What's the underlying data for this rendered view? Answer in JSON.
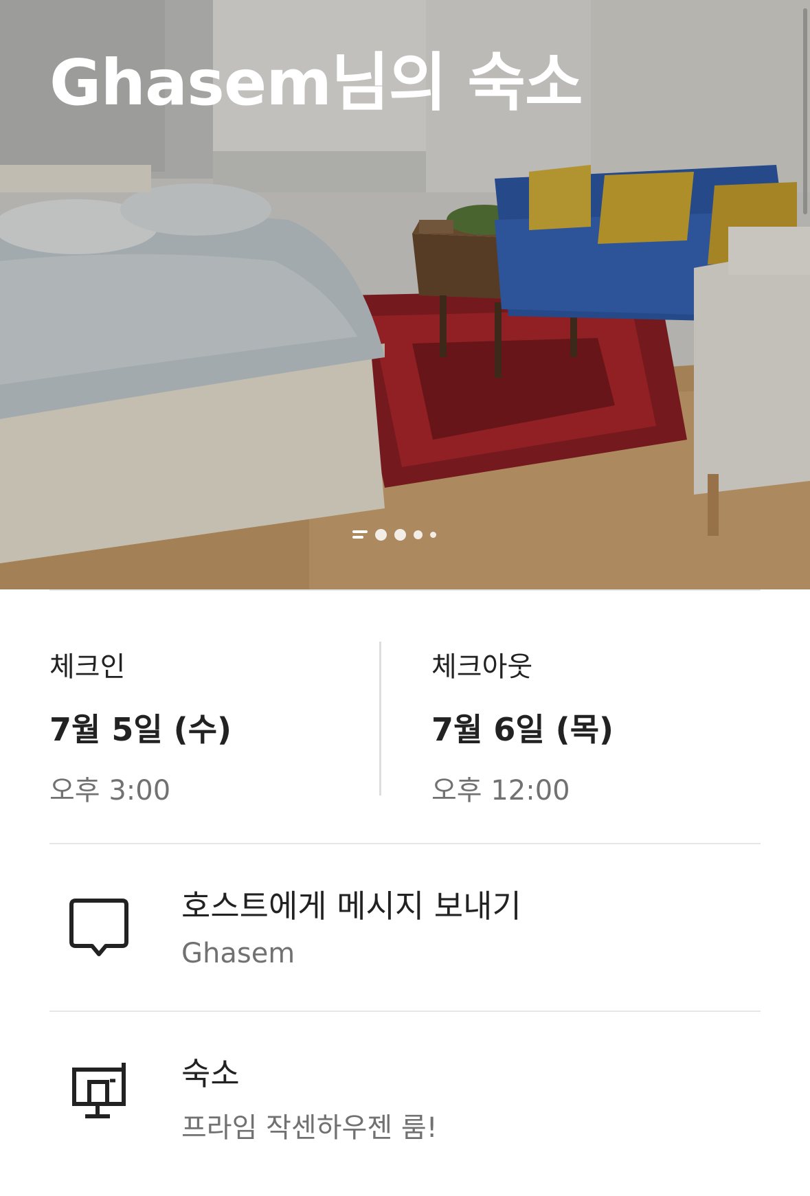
{
  "listing": {
    "title": "Ghasem님의 숙소",
    "photo_count": 5,
    "active_photo_index": 0
  },
  "checkin": {
    "label": "체크인",
    "date": "7월 5일 (수)",
    "time": "오후 3:00"
  },
  "checkout": {
    "label": "체크아웃",
    "date": "7월 6일 (목)",
    "time": "오후 12:00"
  },
  "message_host": {
    "title": "호스트에게 메시지 보내기",
    "subtitle": "Ghasem",
    "icon": "chat-bubble-icon"
  },
  "listing_row": {
    "title": "숙소",
    "subtitle": "프라임 작센하우젠 룸!",
    "icon": "house-icon"
  },
  "colors": {
    "text_primary": "#222222",
    "text_secondary": "#717171",
    "divider": "#e6e6e6"
  }
}
